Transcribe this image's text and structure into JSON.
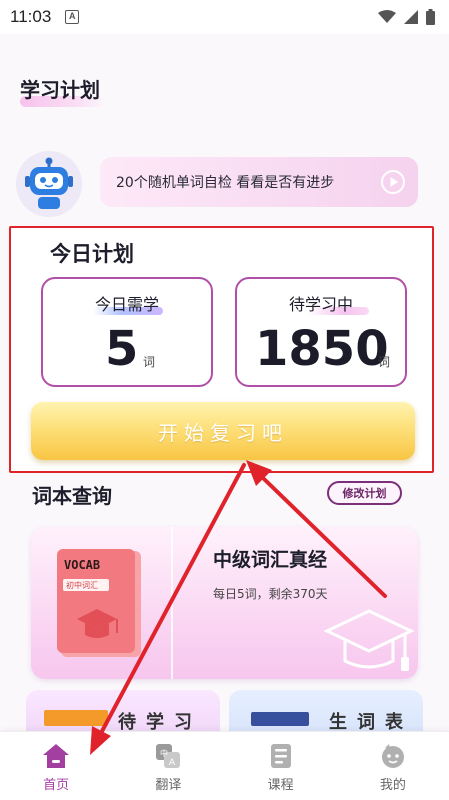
{
  "status_bar": {
    "time": "11:03",
    "notification_letter": "A"
  },
  "page": {
    "title": "学习计划"
  },
  "robot_banner": {
    "text": "20个随机单词自检 看看是否有进步"
  },
  "today_plan": {
    "title": "今日计划",
    "need_label": "今日需学",
    "need_value": "5",
    "need_unit": "词",
    "pending_label": "待学习中",
    "pending_value": "1850",
    "pending_unit": "词",
    "start_button": "开始复习吧"
  },
  "vocab_section": {
    "title": "词本查询",
    "edit_button": "修改计划",
    "book_cover_title": "VOCAB",
    "book_cover_subtitle": "初中词汇",
    "level_title": "中级词汇真经",
    "level_sub": "每日5词，剩余370天"
  },
  "bottom_cards": {
    "left_label": "待学习",
    "right_label": "生词表"
  },
  "nav": [
    {
      "label": "首页",
      "icon": "home-icon",
      "active": true
    },
    {
      "label": "翻译",
      "icon": "translate-icon",
      "active": false
    },
    {
      "label": "课程",
      "icon": "course-icon",
      "active": false
    },
    {
      "label": "我的",
      "icon": "profile-icon",
      "active": false
    }
  ],
  "colors": {
    "accent": "#a43fa2",
    "highlight_box": "#e0232b",
    "start_button": "#fde07a",
    "arrow": "#e0232b"
  }
}
